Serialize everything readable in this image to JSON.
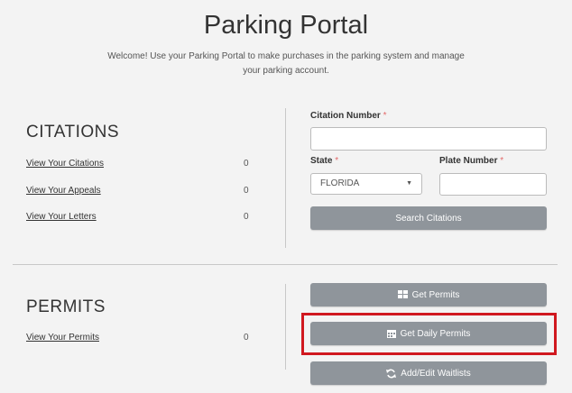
{
  "header": {
    "title": "Parking Portal",
    "welcome_line1": "Welcome! Use your Parking Portal to make purchases in the parking system and manage",
    "welcome_line2": "your parking account."
  },
  "citations": {
    "heading": "CITATIONS",
    "rows": [
      {
        "label": "View Your Citations",
        "count": "0"
      },
      {
        "label": "View Your Appeals",
        "count": "0"
      },
      {
        "label": "View Your Letters",
        "count": "0"
      }
    ],
    "form": {
      "citation_number_label": "Citation Number",
      "citation_number_value": "",
      "state_label": "State",
      "state_value": "FLORIDA",
      "plate_number_label": "Plate Number",
      "plate_number_value": "",
      "required_marker": "*",
      "search_button": "Search Citations"
    }
  },
  "permits": {
    "heading": "PERMITS",
    "rows": [
      {
        "label": "View Your Permits",
        "count": "0"
      }
    ],
    "buttons": {
      "get_permits": "Get Permits",
      "get_daily_permits": "Get Daily Permits",
      "add_edit_waitlists": "Add/Edit Waitlists"
    }
  },
  "colors": {
    "button_bg": "#8f959b",
    "highlight": "#d0181f",
    "required": "#e36a6a"
  },
  "icons": {
    "get_permits": "grid-icon",
    "get_daily_permits": "calendar-icon",
    "add_edit_waitlists": "refresh-icon",
    "state_select": "caret-down-icon"
  }
}
